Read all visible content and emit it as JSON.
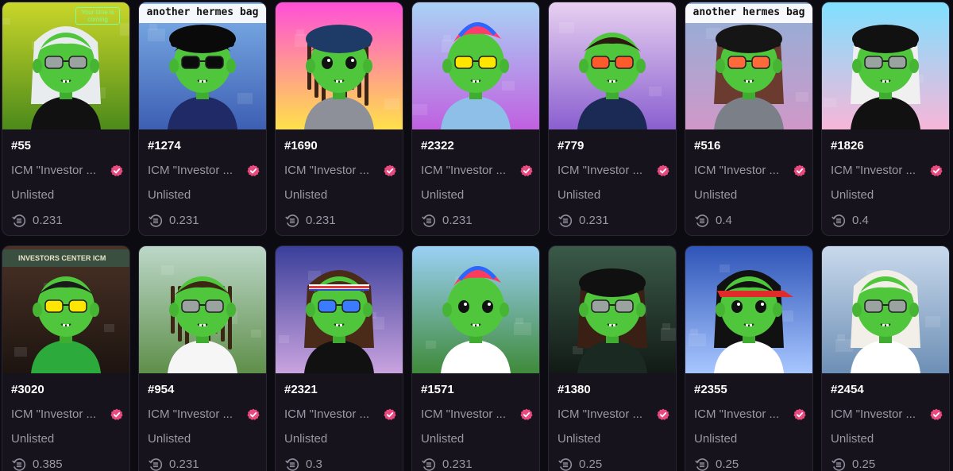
{
  "icons": {
    "verified": "verified-badge-icon",
    "price": "solana-price-icon"
  },
  "colors": {
    "background": "#0d0b12",
    "card": "#16131d",
    "verified_badge": "#e8497f",
    "avatar_skin": "#4fc63b"
  },
  "cards": [
    {
      "id": "#55",
      "collection": "ICM \"Investor ...",
      "status": "Unlisted",
      "price": "0.231",
      "neon_text": "Your time is coming"
    },
    {
      "id": "#1274",
      "collection": "ICM \"Investor ...",
      "status": "Unlisted",
      "price": "0.231",
      "caption": "another hermes bag"
    },
    {
      "id": "#1690",
      "collection": "ICM \"Investor ...",
      "status": "Unlisted",
      "price": "0.231"
    },
    {
      "id": "#2322",
      "collection": "ICM \"Investor ...",
      "status": "Unlisted",
      "price": "0.231"
    },
    {
      "id": "#779",
      "collection": "ICM \"Investor ...",
      "status": "Unlisted",
      "price": "0.231"
    },
    {
      "id": "#516",
      "collection": "ICM \"Investor ...",
      "status": "Unlisted",
      "price": "0.4",
      "caption": "another hermes bag"
    },
    {
      "id": "#1826",
      "collection": "ICM \"Investor ...",
      "status": "Unlisted",
      "price": "0.4"
    },
    {
      "id": "#3020",
      "collection": "ICM \"Investor ...",
      "status": "Unlisted",
      "price": "0.385",
      "sign_text": "INVESTORS CENTER  ICM"
    },
    {
      "id": "#954",
      "collection": "ICM \"Investor ...",
      "status": "Unlisted",
      "price": "0.231"
    },
    {
      "id": "#2321",
      "collection": "ICM \"Investor ...",
      "status": "Unlisted",
      "price": "0.3"
    },
    {
      "id": "#1571",
      "collection": "ICM \"Investor ...",
      "status": "Unlisted",
      "price": "0.231"
    },
    {
      "id": "#1380",
      "collection": "ICM \"Investor ...",
      "status": "Unlisted",
      "price": "0.25"
    },
    {
      "id": "#2355",
      "collection": "ICM \"Investor ...",
      "status": "Unlisted",
      "price": "0.25"
    },
    {
      "id": "#2454",
      "collection": "ICM \"Investor ...",
      "status": "Unlisted",
      "price": "0.25"
    }
  ]
}
